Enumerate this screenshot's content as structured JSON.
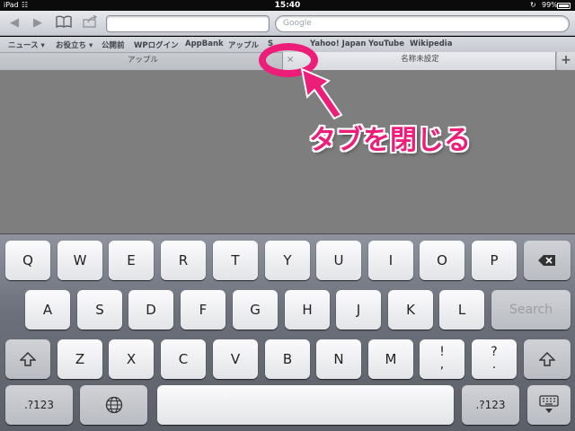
{
  "status": {
    "device": "iPad",
    "time": "15:40",
    "battery": "99%"
  },
  "toolbar": {
    "search_placeholder": "Google"
  },
  "bookmarks": [
    "ニュース ▾",
    "お役立ち ▾",
    "公開前",
    "WPログイン",
    "AppBank",
    "アップル",
    "S",
    "Yahoo! Japan",
    "YouTube",
    "Wikipedia"
  ],
  "tabs": [
    {
      "label": "アップル",
      "active": false
    },
    {
      "label": "名称未設定",
      "active": true
    }
  ],
  "annotation": {
    "text": "タブを閉じる",
    "color": "#ec1e79"
  },
  "keyboard": {
    "row1": [
      "Q",
      "W",
      "E",
      "R",
      "T",
      "Y",
      "U",
      "I",
      "O",
      "P"
    ],
    "row2": [
      "A",
      "S",
      "D",
      "F",
      "G",
      "H",
      "J",
      "K",
      "L"
    ],
    "row3": [
      "Z",
      "X",
      "C",
      "V",
      "B",
      "N",
      "M"
    ],
    "search_label": "Search",
    "punct1": [
      "!",
      ","
    ],
    "punct2": [
      "?",
      "."
    ],
    "numbers_label": ".?123"
  },
  "icons": {
    "back": "◀",
    "forward": "▶",
    "bookmarks": "book",
    "share": "share",
    "close_tab": "×",
    "new_tab": "+",
    "backspace": "backspace",
    "shift": "shift",
    "globe": "globe",
    "hide_keyboard": "keyboard"
  }
}
